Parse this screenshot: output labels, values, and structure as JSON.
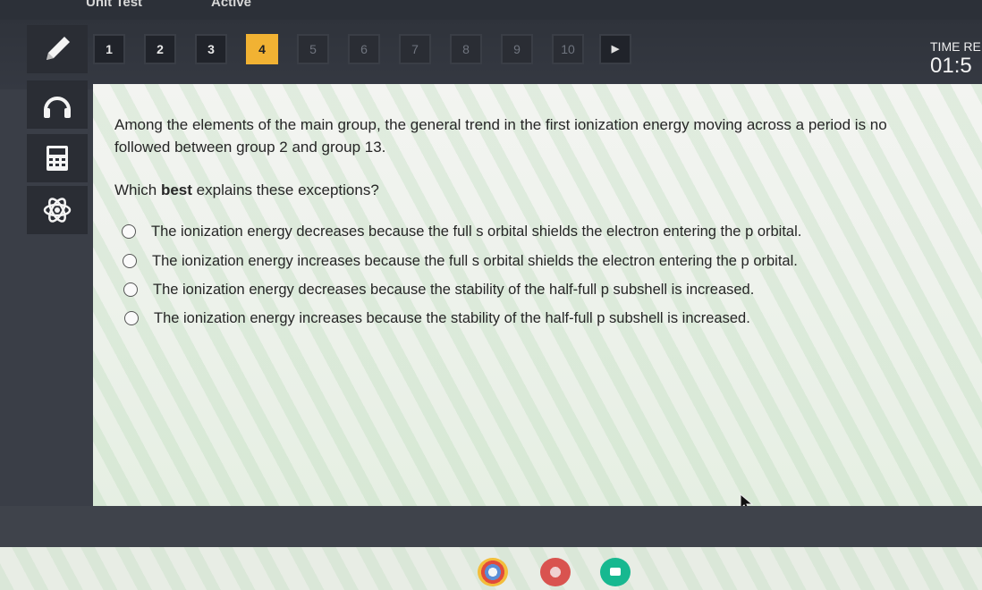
{
  "top": {
    "title": "Unit Test",
    "status": "Active"
  },
  "questions": {
    "numbers": [
      "1",
      "2",
      "3",
      "4",
      "5",
      "6",
      "7",
      "8",
      "9",
      "10"
    ],
    "current": "4",
    "next_icon": "play-triangle-icon"
  },
  "timer": {
    "label": "TIME RE",
    "value": "01:5"
  },
  "tools": [
    "pencil-icon",
    "headphones-icon",
    "calculator-icon",
    "atom-icon"
  ],
  "question": {
    "line1": "Among the elements of the main group, the general trend in the first ionization energy moving across a period is no",
    "line2": "followed between group 2 and group 13.",
    "prompt_pre": "Which ",
    "prompt_bold": "best",
    "prompt_post": " explains these exceptions?"
  },
  "choices": [
    "The ionization energy decreases because the full s orbital shields the electron entering the p orbital.",
    "The ionization energy increases because the full s orbital shields the electron entering the p orbital.",
    "The ionization energy decreases because the stability of the half-full p subshell is increased.",
    "The ionization energy increases because the stability of the half-full p subshell is increased."
  ],
  "colors": {
    "accent": "#f1b233",
    "header": "#30343c",
    "panel": "#eef1ec"
  },
  "taskbar": [
    "chrome-icon",
    "app-icon",
    "video-icon"
  ]
}
